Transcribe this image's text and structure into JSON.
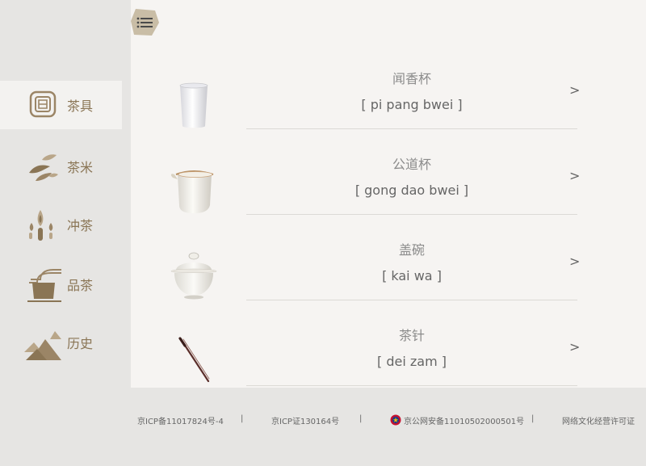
{
  "sidebar": {
    "items": [
      {
        "label": "茶具",
        "icon": "teaware-icon",
        "active": true
      },
      {
        "label": "茶米",
        "icon": "tea-leaf-icon",
        "active": false
      },
      {
        "label": "冲茶",
        "icon": "brew-icon",
        "active": false
      },
      {
        "label": "品茶",
        "icon": "tea-tasting-icon",
        "active": false
      },
      {
        "label": "历史",
        "icon": "mountain-icon",
        "active": false
      }
    ]
  },
  "header": {
    "menu_icon": "list-menu-icon"
  },
  "main": {
    "items": [
      {
        "name": "闻香杯",
        "pronunciation": "[ pi pang bwei ]",
        "arrow": ">",
        "image": "aroma-cup-image"
      },
      {
        "name": "公道杯",
        "pronunciation": "[ gong dao bwei ]",
        "arrow": ">",
        "image": "fair-cup-image"
      },
      {
        "name": "盖碗",
        "pronunciation": "[ kai wa ]",
        "arrow": ">",
        "image": "lidded-bowl-image"
      },
      {
        "name": "茶针",
        "pronunciation": "[ dei zam ]",
        "arrow": ">",
        "image": "tea-needle-image"
      }
    ]
  },
  "footer": {
    "icp": "京ICP备11017824号-4",
    "sep1": "|",
    "icp_license": "京ICP证130164号",
    "sep2": "|",
    "public_security": "京公网安备11010502000501号",
    "sep3": "|",
    "culture_license": "网络文化经营许可证"
  },
  "colors": {
    "accent": "#8a7555",
    "icon_tan": "#b9a689",
    "main_bg": "#f6f4f2",
    "sidebar_bg": "#e6e5e3"
  }
}
